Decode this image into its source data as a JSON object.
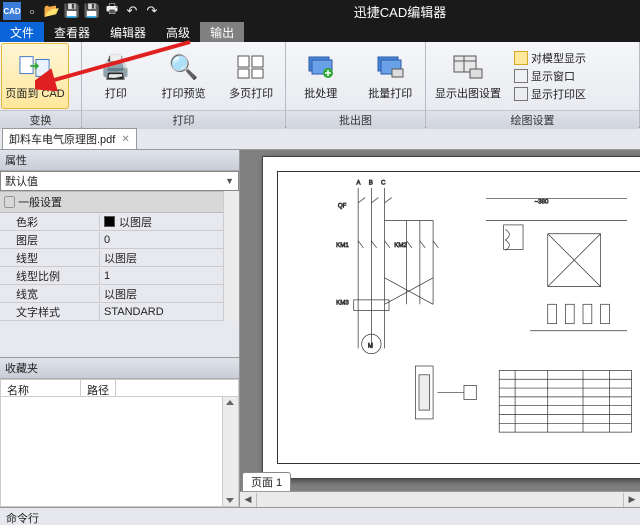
{
  "app": {
    "title": "迅捷CAD编辑器"
  },
  "qat": {
    "icons": [
      "app",
      "new",
      "open",
      "save",
      "saveas",
      "print",
      "undo",
      "redo"
    ]
  },
  "menus": {
    "file": "文件",
    "viewer": "查看器",
    "editor": "编辑器",
    "advanced": "高级",
    "output": "输出"
  },
  "ribbon": {
    "groups": {
      "convert": {
        "label": "变换",
        "page_to_cad": "页面到 CAD"
      },
      "print": {
        "label": "打印",
        "print": "打印",
        "preview": "打印预览",
        "multi": "多页打印"
      },
      "batch": {
        "label": "批出图",
        "batch": "批处理",
        "batch_print": "批量打印"
      },
      "plot_set": {
        "label": "绘图设置",
        "show_set": "显示出图设置",
        "side_model": "对模型显示",
        "side_win": "显示窗口",
        "side_area": "显示打印区"
      }
    }
  },
  "doc": {
    "tab": "卸料车电气原理图.pdf"
  },
  "props": {
    "panel_title": "属性",
    "default": "默认值",
    "section": "一般设置",
    "rows": {
      "color": {
        "name": "色彩",
        "value": "以图层"
      },
      "layer": {
        "name": "图层",
        "value": "0"
      },
      "ltype": {
        "name": "线型",
        "value": "以图层"
      },
      "lscale": {
        "name": "线型比例",
        "value": "1"
      },
      "lweight": {
        "name": "线宽",
        "value": "以图层"
      },
      "tstyle": {
        "name": "文字样式",
        "value": "STANDARD"
      }
    }
  },
  "fav": {
    "title": "收藏夹",
    "col_name": "名称",
    "col_path": "路径"
  },
  "page_tab": "页面 1",
  "status": "命令行",
  "schematic": {
    "labels": {
      "qf": "QF",
      "km1": "KM1",
      "km2": "KM2",
      "km3": "KM3",
      "m": "M",
      "volt": "~380"
    }
  }
}
